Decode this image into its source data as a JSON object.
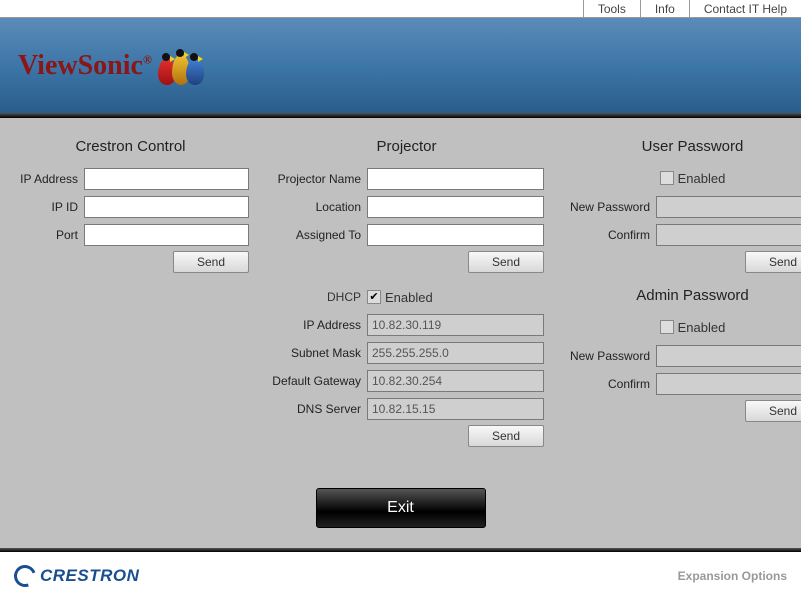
{
  "topbar": {
    "tools": "Tools",
    "info": "Info",
    "contact": "Contact IT Help"
  },
  "brand": "ViewSonic",
  "sections": {
    "crestron": {
      "title": "Crestron Control",
      "ip_label": "IP Address",
      "ip_value": "",
      "ipid_label": "IP ID",
      "ipid_value": "",
      "port_label": "Port",
      "port_value": "",
      "send": "Send"
    },
    "projector": {
      "title": "Projector",
      "name_label": "Projector Name",
      "name_value": "",
      "location_label": "Location",
      "location_value": "",
      "assigned_label": "Assigned To",
      "assigned_value": "",
      "send1": "Send",
      "dhcp_label": "DHCP",
      "dhcp_enabled_text": "Enabled",
      "ip_label": "IP Address",
      "ip_value": "10.82.30.119",
      "subnet_label": "Subnet Mask",
      "subnet_value": "255.255.255.0",
      "gateway_label": "Default Gateway",
      "gateway_value": "10.82.30.254",
      "dns_label": "DNS Server",
      "dns_value": "10.82.15.15",
      "send2": "Send"
    },
    "user_pw": {
      "title": "User Password",
      "enabled_text": "Enabled",
      "new_label": "New Password",
      "confirm_label": "Confirm",
      "send": "Send"
    },
    "admin_pw": {
      "title": "Admin Password",
      "enabled_text": "Enabled",
      "new_label": "New Password",
      "confirm_label": "Confirm",
      "send": "Send"
    }
  },
  "exit": "Exit",
  "footer": {
    "crestron": "CRESTRON",
    "expansion": "Expansion Options"
  }
}
